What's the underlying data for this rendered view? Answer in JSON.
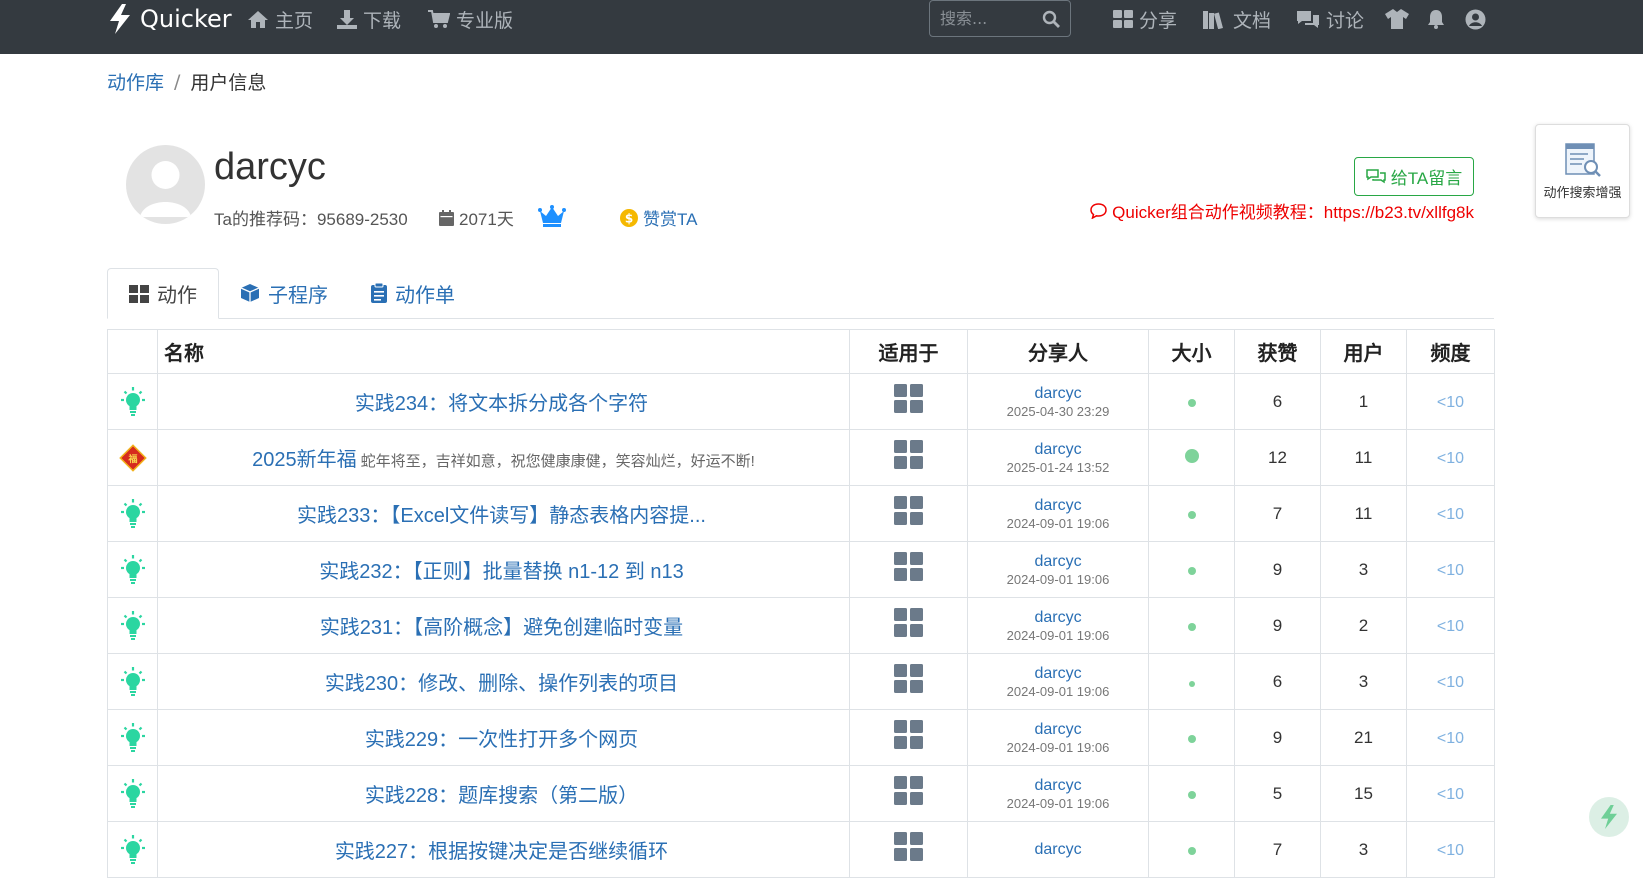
{
  "nav": {
    "brand": "Quicker",
    "home": "主页",
    "download": "下载",
    "pro": "专业版",
    "search_placeholder": "搜索...",
    "share": "分享",
    "docs": "文档",
    "discuss": "讨论"
  },
  "breadcrumb": {
    "library": "动作库",
    "separator": "/",
    "current": "用户信息"
  },
  "profile": {
    "username": "darcyc",
    "referral": "Ta的推荐码：95689-2530",
    "days": "2071天",
    "donate": "赞赏TA",
    "message_button": "给TA留言",
    "promo": "Quicker组合动作视频教程：https://b23.tv/xllfg8k"
  },
  "side_widget": {
    "label": "动作搜索增强"
  },
  "tabs": [
    {
      "label": "动作",
      "icon": "grid-icon"
    },
    {
      "label": "子程序",
      "icon": "cube-icon"
    },
    {
      "label": "动作单",
      "icon": "clipboard-icon"
    }
  ],
  "table": {
    "headers": [
      "名称",
      "适用于",
      "分享人",
      "大小",
      "获赞",
      "用户",
      "频度"
    ],
    "rows": [
      {
        "icon": "lightbulb-icon",
        "title": "实践234：将文本拆分成各个字符",
        "desc": "",
        "sharer": "darcyc",
        "date": "2025-04-30 23:29",
        "size": "small",
        "likes": "6",
        "users": "1",
        "freq": "<10"
      },
      {
        "icon": "fu-diamond-icon",
        "title": "2025新年福",
        "desc": "蛇年将至，吉祥如意，祝您健康康健，笑容灿烂，好运不断!",
        "sharer": "darcyc",
        "date": "2025-01-24 13:52",
        "size": "medium",
        "likes": "12",
        "users": "11",
        "freq": "<10"
      },
      {
        "icon": "lightbulb-icon",
        "title": "实践233：【Excel文件读写】静态表格内容提...",
        "desc": "",
        "sharer": "darcyc",
        "date": "2024-09-01 19:06",
        "size": "small",
        "likes": "7",
        "users": "11",
        "freq": "<10"
      },
      {
        "icon": "lightbulb-icon",
        "title": "实践232：【正则】批量替换 n1-12 到 n13",
        "desc": "",
        "sharer": "darcyc",
        "date": "2024-09-01 19:06",
        "size": "small",
        "likes": "9",
        "users": "3",
        "freq": "<10"
      },
      {
        "icon": "lightbulb-icon",
        "title": "实践231：【高阶概念】避免创建临时变量",
        "desc": "",
        "sharer": "darcyc",
        "date": "2024-09-01 19:06",
        "size": "small",
        "likes": "9",
        "users": "2",
        "freq": "<10"
      },
      {
        "icon": "lightbulb-icon",
        "title": "实践230：修改、删除、操作列表的项目",
        "desc": "",
        "sharer": "darcyc",
        "date": "2024-09-01 19:06",
        "size": "tiny",
        "likes": "6",
        "users": "3",
        "freq": "<10"
      },
      {
        "icon": "lightbulb-icon",
        "title": "实践229：一次性打开多个网页",
        "desc": "",
        "sharer": "darcyc",
        "date": "2024-09-01 19:06",
        "size": "small",
        "likes": "9",
        "users": "21",
        "freq": "<10"
      },
      {
        "icon": "lightbulb-icon",
        "title": "实践228：题库搜索（第二版）",
        "desc": "",
        "sharer": "darcyc",
        "date": "2024-09-01 19:06",
        "size": "small",
        "likes": "5",
        "users": "15",
        "freq": "<10"
      },
      {
        "icon": "lightbulb-icon",
        "title": "实践227：根据按键决定是否继续循环",
        "desc": "",
        "sharer": "darcyc",
        "date": "",
        "size": "small",
        "likes": "7",
        "users": "3",
        "freq": "<10"
      }
    ]
  },
  "colors": {
    "navbar": "#343a40",
    "link": "#2a6fb4",
    "green": "#28a745",
    "promo": "#ee0000",
    "icon_teal": "#2bd6a1"
  }
}
